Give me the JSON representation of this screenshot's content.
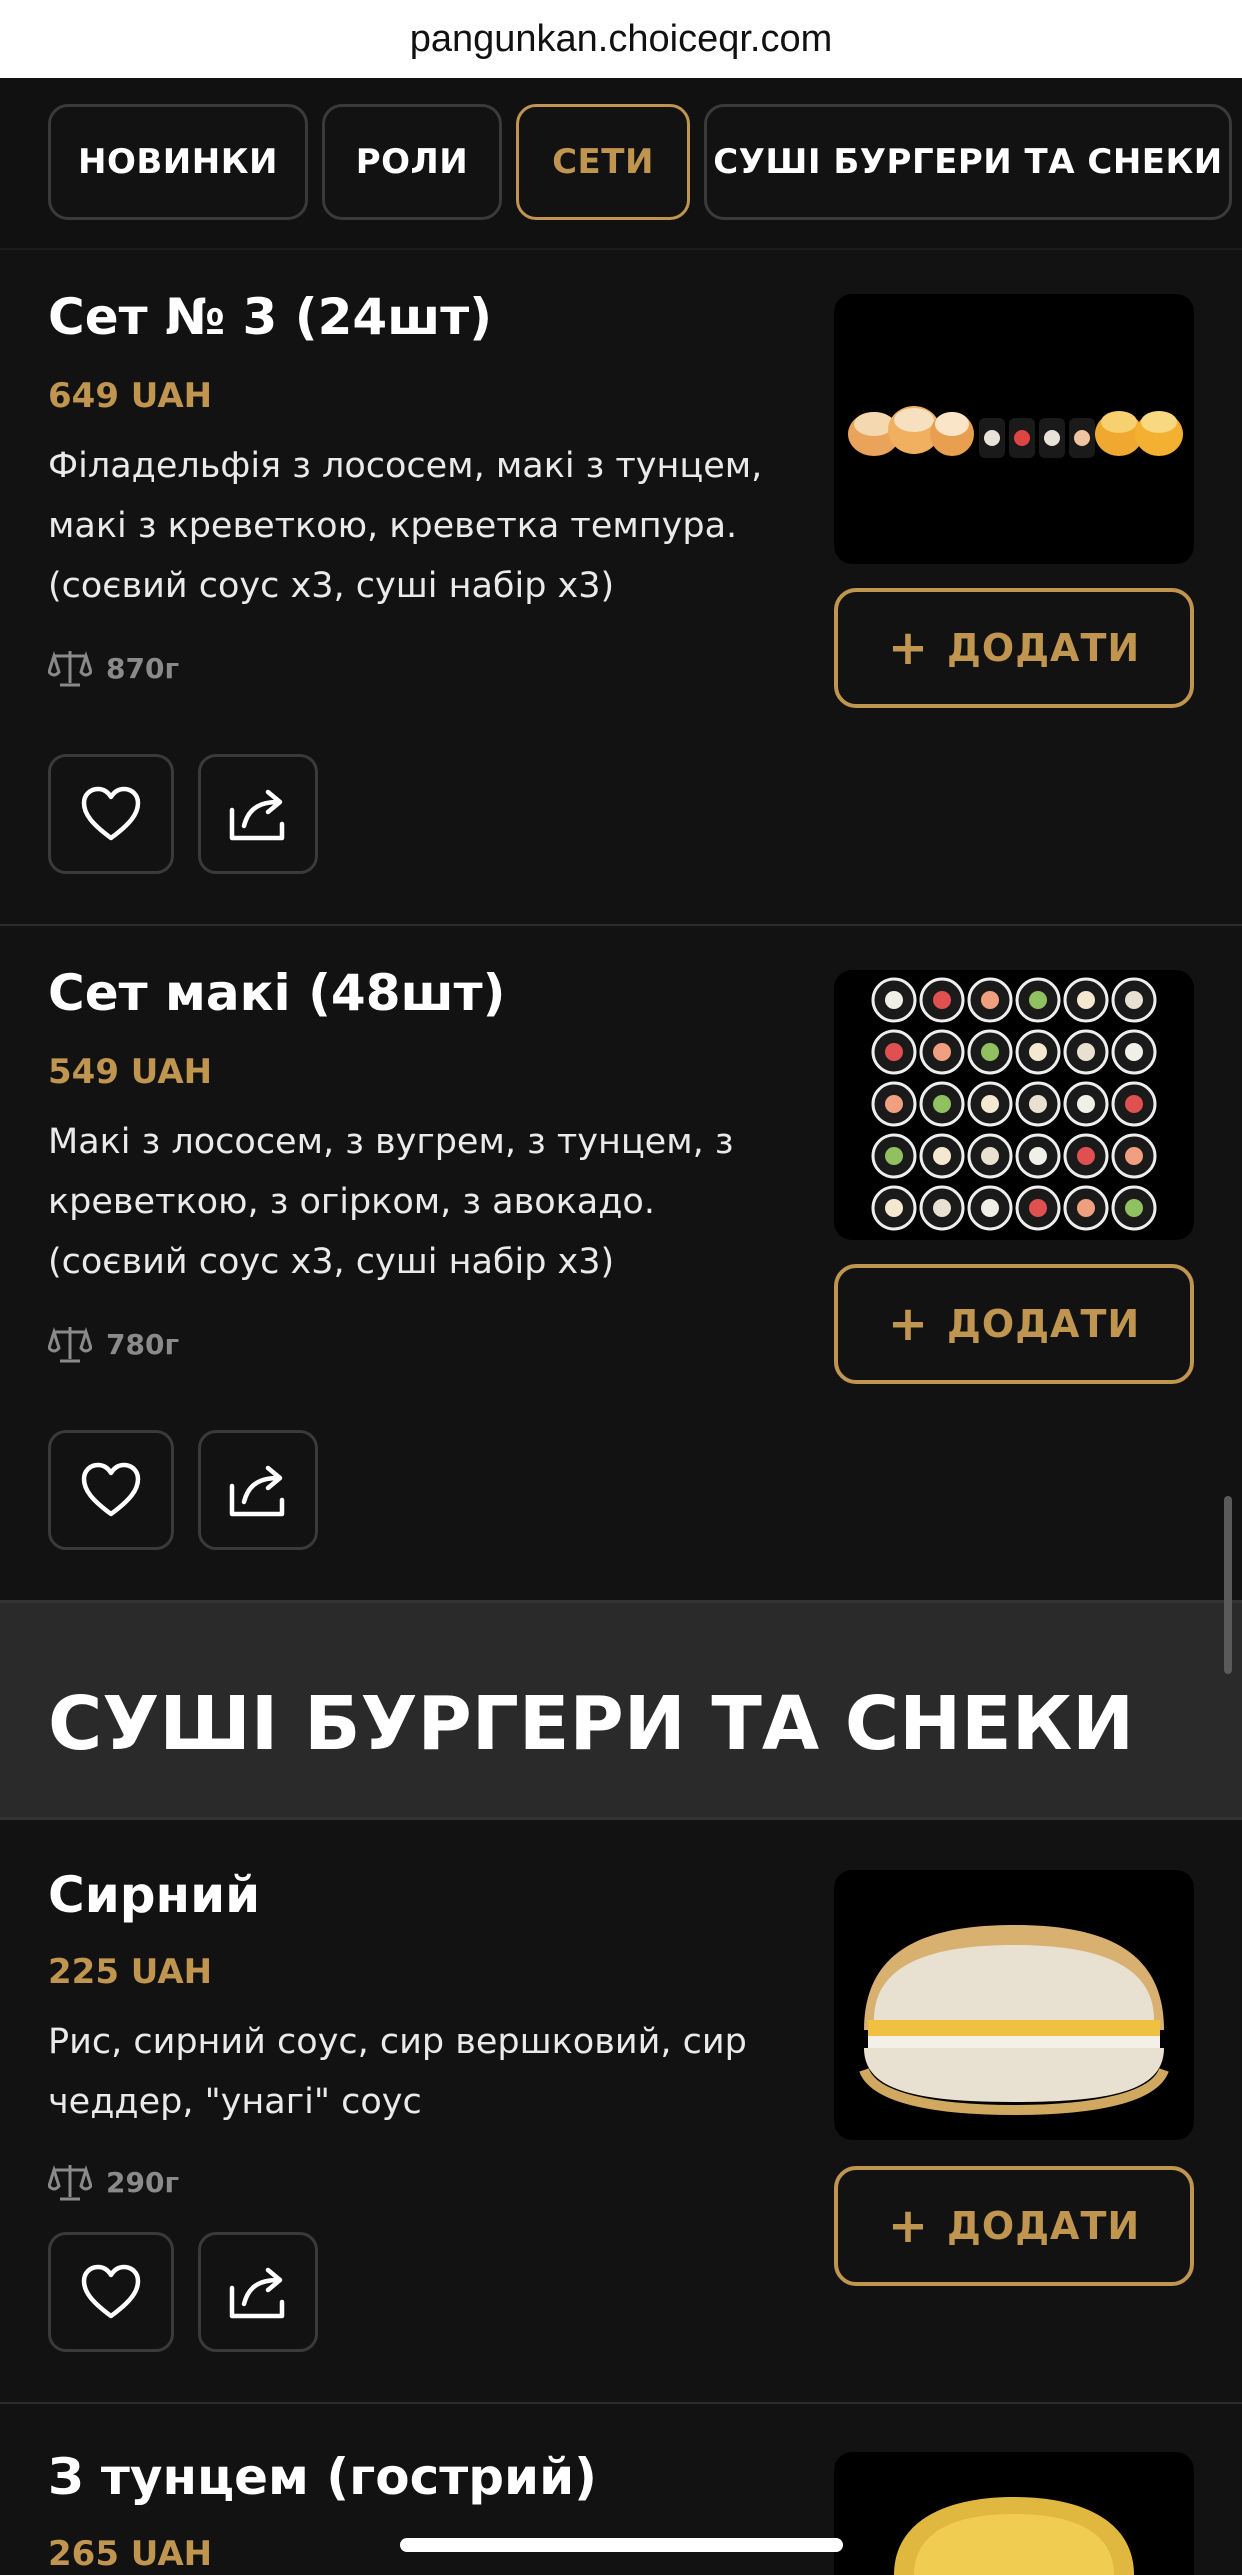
{
  "browser": {
    "url": "pangunkan.choiceqr.com"
  },
  "tabs": [
    {
      "label": "НОВИНКИ"
    },
    {
      "label": "РОЛИ"
    },
    {
      "label": "СЕТИ"
    },
    {
      "label": "СУШІ БУРГЕРИ ТА СНЕКИ"
    }
  ],
  "active_tab": "СЕТИ",
  "add_label": "ДОДАТИ",
  "items": [
    {
      "title": "Сет № 3 (24шт)",
      "price": "649 UAH",
      "desc_lines": [
        "Філадельфія з лососем, макі з тунцем,",
        "макі з креветкою, креветка темпура.",
        "(соєвий соус х3, суші набір х3)"
      ],
      "weight": "870г",
      "photo_icon": "sushi-set-photo"
    },
    {
      "title": "Сет макі (48шт)",
      "price": "549 UAH",
      "desc_lines": [
        "Макі з лососем, з вугрем, з тунцем, з",
        "креветкою, з огірком, з авокадо.",
        "(соєвий соус х3, суші набір х3)"
      ],
      "weight": "780г",
      "photo_icon": "maki-set-photo"
    },
    {
      "title": "Сирний",
      "price": "225 UAH",
      "desc_lines": [
        "Рис, сирний соус, сир вершковий, сир",
        "чеддер, \"унагі\" соус"
      ],
      "weight": "290г",
      "photo_icon": "sushi-burger-photo"
    },
    {
      "title": "З тунцем (гострий)",
      "price": "265 UAH",
      "photo_icon": "sushi-burger-photo"
    }
  ],
  "section": {
    "title": "СУШІ БУРГЕРИ ТА СНЕКИ"
  },
  "colors": {
    "accent": "#c0954f",
    "background": "#121212",
    "section_bg": "#2a2a2a"
  }
}
